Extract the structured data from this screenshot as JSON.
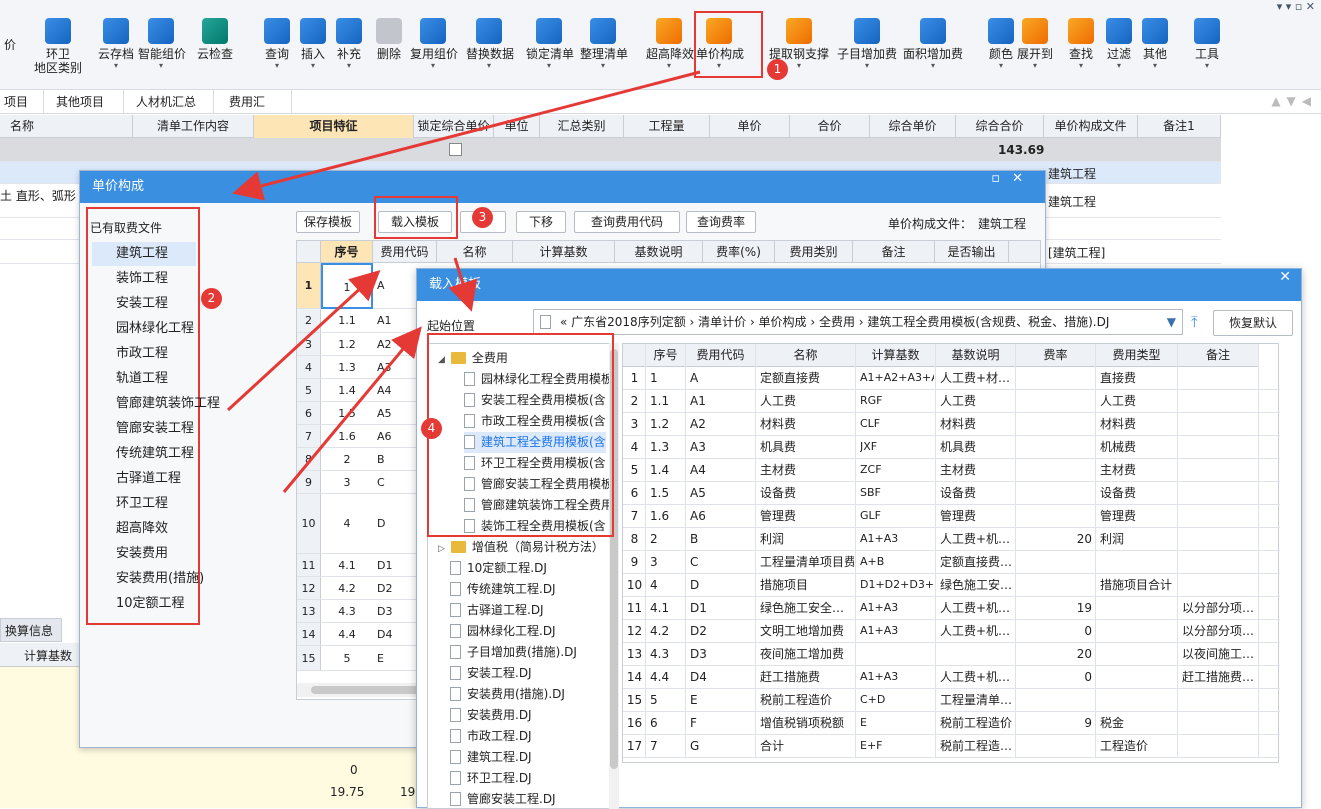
{
  "toolbar": {
    "items": [
      {
        "label": "价",
        "icon": "price-icon"
      },
      {
        "label": "环卫",
        "label2": "地区类别",
        "icon": "region-icon"
      },
      {
        "label": "云存档",
        "icon": "cloud-save-icon"
      },
      {
        "label": "智能组价",
        "icon": "smart-price-icon"
      },
      {
        "label": "云检查",
        "icon": "cloud-check-icon"
      },
      {
        "label": "查询",
        "icon": "query-icon"
      },
      {
        "label": "插入",
        "icon": "insert-icon"
      },
      {
        "label": "补充",
        "icon": "supplement-icon"
      },
      {
        "label": "删除",
        "icon": "delete-icon"
      },
      {
        "label": "复用组价",
        "icon": "reuse-price-icon"
      },
      {
        "label": "替换数据",
        "icon": "replace-data-icon"
      },
      {
        "label": "锁定清单",
        "icon": "lock-icon"
      },
      {
        "label": "整理清单",
        "icon": "organize-list-icon"
      },
      {
        "label": "超高降效",
        "icon": "height-efficiency-icon"
      },
      {
        "label": "单价构成",
        "icon": "unit-price-icon"
      },
      {
        "label": "提取钢支撑",
        "icon": "steel-support-icon"
      },
      {
        "label": "子目增加费",
        "icon": "item-fee-icon"
      },
      {
        "label": "面积增加费",
        "icon": "area-fee-icon"
      },
      {
        "label": "颜色",
        "icon": "color-icon"
      },
      {
        "label": "展开到",
        "icon": "expand-icon"
      },
      {
        "label": "查找",
        "icon": "find-icon"
      },
      {
        "label": "过滤",
        "icon": "filter-icon"
      },
      {
        "label": "其他",
        "icon": "other-icon"
      },
      {
        "label": "工具",
        "icon": "tools-icon"
      }
    ]
  },
  "tabs": [
    "项目",
    "其他项目",
    "人材机汇总",
    "费用汇总"
  ],
  "main_headers": [
    "名称",
    "清单工作内容",
    "项目特征",
    "锁定综合单价",
    "单位",
    "汇总类别",
    "工程量",
    "单价",
    "合价",
    "综合单价",
    "综合合价",
    "单价构成文件",
    "备注1"
  ],
  "main_rows": {
    "total": "143.69",
    "r1_name": "土 直形、弧形",
    "r1_file": "建筑工程",
    "r2_file": "建筑工程",
    "r3_file": "[建筑工程]"
  },
  "bottom": {
    "tab": "换算信息",
    "col": "计算基数",
    "v1": "0",
    "v2": "19.75",
    "v3": "19."
  },
  "dialog1": {
    "title": "单价构成",
    "left_label": "已有取费文件",
    "files": [
      "建筑工程",
      "装饰工程",
      "安装工程",
      "园林绿化工程",
      "市政工程",
      "轨道工程",
      "管廊建筑装饰工程",
      "管廊安装工程",
      "传统建筑工程",
      "古驿道工程",
      "环卫工程",
      "超高降效",
      "安装费用",
      "安装费用(措施)",
      "10定额工程"
    ],
    "buttons": [
      "保存模板",
      "载入模板",
      "下移",
      "查询费用代码",
      "查询费率"
    ],
    "file_label": "单价构成文件：",
    "file_value": "建筑工程",
    "headers": [
      "序号",
      "费用代码",
      "名称",
      "计算基数",
      "基数说明",
      "费率(%)",
      "费用类别",
      "备注",
      "是否输出"
    ],
    "rows": [
      {
        "rn": "1",
        "seq": "1",
        "code": "A"
      },
      {
        "rn": "2",
        "seq": "1.1",
        "code": "A1"
      },
      {
        "rn": "3",
        "seq": "1.2",
        "code": "A2"
      },
      {
        "rn": "4",
        "seq": "1.3",
        "code": "A3"
      },
      {
        "rn": "5",
        "seq": "1.4",
        "code": "A4"
      },
      {
        "rn": "6",
        "seq": "1.5",
        "code": "A5"
      },
      {
        "rn": "7",
        "seq": "1.6",
        "code": "A6"
      },
      {
        "rn": "8",
        "seq": "2",
        "code": "B"
      },
      {
        "rn": "9",
        "seq": "3",
        "code": "C"
      },
      {
        "rn": "10",
        "seq": "4",
        "code": "D"
      },
      {
        "rn": "11",
        "seq": "4.1",
        "code": "D1"
      },
      {
        "rn": "12",
        "seq": "4.2",
        "code": "D2"
      },
      {
        "rn": "13",
        "seq": "4.3",
        "code": "D3"
      },
      {
        "rn": "14",
        "seq": "4.4",
        "code": "D4"
      },
      {
        "rn": "15",
        "seq": "5",
        "code": "E"
      }
    ]
  },
  "dialog2": {
    "title": "载入模板",
    "start_label": "起始位置",
    "path": "« 广东省2018序列定额 › 清单计价 › 单价构成 › 全费用 › 建筑工程全费用模板(含规费、税金、措施).DJ",
    "reset_button": "恢复默认",
    "tree_folder": "全费用",
    "tree_children": [
      "园林绿化工程全费用模板",
      "安装工程全费用模板(含",
      "市政工程全费用模板(含",
      "建筑工程全费用模板(含",
      "环卫工程全费用模板(含",
      "管廊安装工程全费用模板",
      "管廊建筑装饰工程全费用",
      "装饰工程全费用模板(含"
    ],
    "tree_folder2": "增值税（简易计税方法）",
    "tree_files": [
      "10定额工程.DJ",
      "传统建筑工程.DJ",
      "古驿道工程.DJ",
      "园林绿化工程.DJ",
      "子目增加费(措施).DJ",
      "安装工程.DJ",
      "安装费用(措施).DJ",
      "安装费用.DJ",
      "市政工程.DJ",
      "建筑工程.DJ",
      "环卫工程.DJ",
      "管廊安装工程.DJ"
    ],
    "headers": [
      "序号",
      "费用代码",
      "名称",
      "计算基数",
      "基数说明",
      "费率",
      "费用类型",
      "备注"
    ],
    "rows": [
      [
        "1",
        "A",
        "定额直接费",
        "A1+A2+A3+A…",
        "人工费+材…",
        "",
        "直接费",
        ""
      ],
      [
        "1.1",
        "A1",
        "人工费",
        "RGF",
        "人工费",
        "",
        "人工费",
        ""
      ],
      [
        "1.2",
        "A2",
        "材料费",
        "CLF",
        "材料费",
        "",
        "材料费",
        ""
      ],
      [
        "1.3",
        "A3",
        "机具费",
        "JXF",
        "机具费",
        "",
        "机械费",
        ""
      ],
      [
        "1.4",
        "A4",
        "主材费",
        "ZCF",
        "主材费",
        "",
        "主材费",
        ""
      ],
      [
        "1.5",
        "A5",
        "设备费",
        "SBF",
        "设备费",
        "",
        "设备费",
        ""
      ],
      [
        "1.6",
        "A6",
        "管理费",
        "GLF",
        "管理费",
        "",
        "管理费",
        ""
      ],
      [
        "2",
        "B",
        "利润",
        "A1+A3",
        "人工费+机…",
        "20",
        "利润",
        ""
      ],
      [
        "3",
        "C",
        "工程量清单项目费",
        "A+B",
        "定额直接费…",
        "",
        "",
        ""
      ],
      [
        "4",
        "D",
        "措施项目",
        "D1+D2+D3+D4",
        "绿色施工安…",
        "",
        "措施项目合计",
        ""
      ],
      [
        "4.1",
        "D1",
        "绿色施工安全…",
        "A1+A3",
        "人工费+机…",
        "19",
        "",
        "以分部分项…"
      ],
      [
        "4.2",
        "D2",
        "文明工地增加费",
        "A1+A3",
        "人工费+机…",
        "0",
        "",
        "以分部分项…"
      ],
      [
        "4.3",
        "D3",
        "夜间施工增加费",
        "",
        "",
        "20",
        "",
        "以夜间施工…"
      ],
      [
        "4.4",
        "D4",
        "赶工措施费",
        "A1+A3",
        "人工费+机…",
        "0",
        "",
        "赶工措施费…"
      ],
      [
        "5",
        "E",
        "税前工程造价",
        "C+D",
        "工程量清单…",
        "",
        "",
        ""
      ],
      [
        "6",
        "F",
        "增值税销项税额",
        "E",
        "税前工程造价",
        "9",
        "税金",
        ""
      ],
      [
        "7",
        "G",
        "合计",
        "E+F",
        "税前工程造…",
        "",
        "工程造价",
        ""
      ]
    ]
  },
  "callouts": [
    "1",
    "2",
    "3",
    "4"
  ],
  "accent": "#3b8fe0",
  "highlight": "#e53935"
}
